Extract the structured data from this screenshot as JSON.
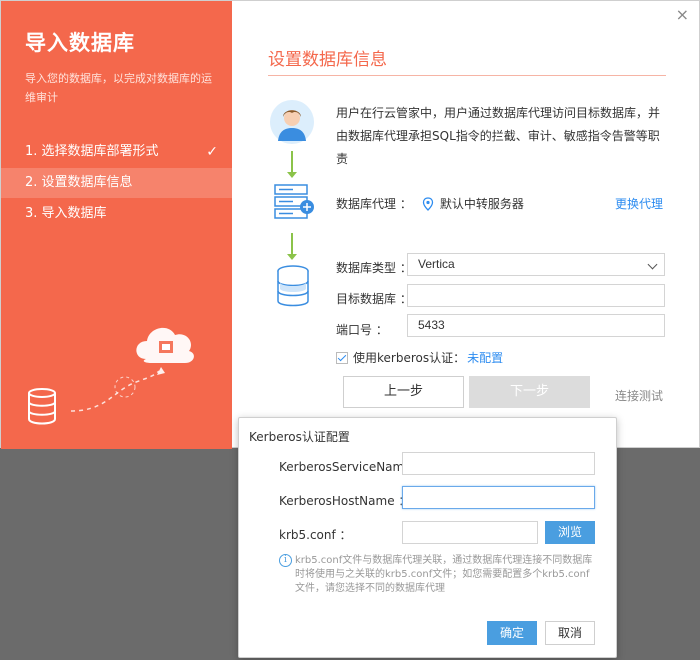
{
  "sidebar": {
    "title": "导入数据库",
    "description": "导入您的数据库，以完成对数据库的运维审计",
    "steps": [
      {
        "label": "1. 选择数据库部署形式",
        "check": "✓"
      },
      {
        "label": "2. 设置数据库信息"
      },
      {
        "label": "3. 导入数据库"
      }
    ],
    "accent": "#f4684c"
  },
  "main": {
    "close": "×",
    "section_title": "设置数据库信息",
    "intro": "用户在行云管家中，用户通过数据库代理访问目标数据库，并由数据库代理承担SQL指令的拦截、审计、敏感指令告警等职责",
    "proxy": {
      "label": "数据库代理 ：",
      "value": "默认中转服务器",
      "change": "更换代理"
    },
    "form": {
      "db_type_label": "数据库类型 ：",
      "db_type_value": "Vertica",
      "target_db_label": "目标数据库 ：",
      "target_db_value": "",
      "port_label": "端口号 ：",
      "port_value": "5433"
    },
    "kerberos": {
      "label": "使用kerberos认证：",
      "link": "未配置"
    },
    "buttons": {
      "prev": "上一步",
      "next": "下一步",
      "test": "连接测试"
    }
  },
  "dialog": {
    "title": "Kerberos认证配置",
    "service_label": "KerberosServiceName：",
    "host_label": "KerberosHostName   ：",
    "krb_label": "krb5.conf               ：",
    "browse": "浏览",
    "info_icon": "i",
    "info": "krb5.conf文件与数据库代理关联，通过数据库代理连接不同数据库时将使用与之关联的krb5.conf文件；如您需要配置多个krb5.conf文件，请您选择不同的数据库代理",
    "ok": "确定",
    "cancel": "取消",
    "primary_color": "#4a9ee0"
  }
}
